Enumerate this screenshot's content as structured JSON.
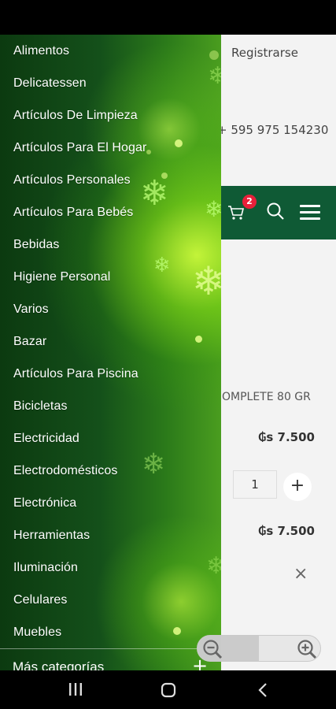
{
  "page": {
    "register_label": "Registrarse",
    "phone": "+ 595 975 154230",
    "cart_count": "2",
    "product_name": "OMPLETE 80 GR",
    "price_unit": "₲s 7.500",
    "quantity": "1",
    "plus_label": "+",
    "price_total": "₲s 7.500",
    "remove_label": "×"
  },
  "drawer": {
    "categories": [
      "Alimentos",
      "Delicatessen",
      "Artículos De Limpieza",
      "Artículos Para El Hogar",
      "Artículos Personales",
      "Artículos Para Bebés",
      "Bebidas",
      "Higiene Personal",
      "Varios",
      "Bazar",
      "Artículos Para Piscina",
      "Bicicletas",
      "Electricidad",
      "Electrodomésticos",
      "Electrónica",
      "Herramientas",
      "Iluminación",
      "Celulares",
      "Muebles"
    ],
    "more_label": "Más categorías",
    "more_plus": "+"
  },
  "colors": {
    "navbar": "#0f5a35",
    "badge": "#e8203a"
  },
  "icons": [
    "cart-icon",
    "search-icon",
    "menu-icon",
    "zoom-out-icon",
    "zoom-in-icon",
    "recent-apps-icon",
    "home-icon",
    "back-icon"
  ]
}
